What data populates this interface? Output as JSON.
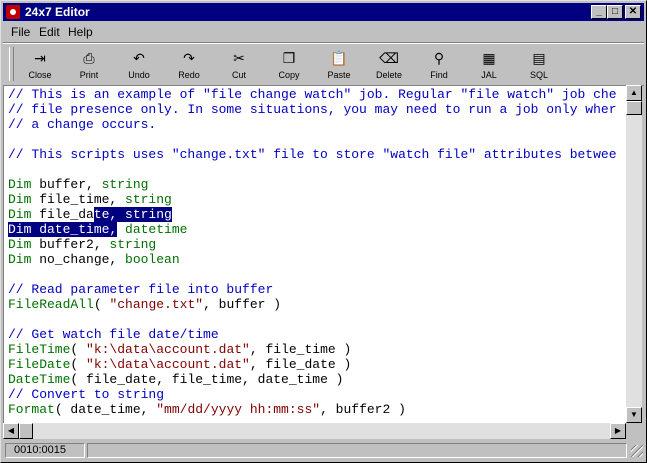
{
  "window": {
    "title": "24x7 Editor",
    "minimize": "_",
    "maximize": "□",
    "close": "✕"
  },
  "menu": [
    "File",
    "Edit",
    "Help"
  ],
  "toolbar": [
    {
      "label": "Close",
      "icon": "close-file-icon",
      "glyph": "⇥"
    },
    {
      "label": "Print",
      "icon": "printer-icon",
      "glyph": "⎙"
    },
    {
      "label": "Undo",
      "icon": "undo-icon",
      "glyph": "↶"
    },
    {
      "label": "Redo",
      "icon": "redo-icon",
      "glyph": "↷"
    },
    {
      "label": "Cut",
      "icon": "scissors-icon",
      "glyph": "✂"
    },
    {
      "label": "Copy",
      "icon": "copy-icon",
      "glyph": "❐"
    },
    {
      "label": "Paste",
      "icon": "clipboard-icon",
      "glyph": "📋"
    },
    {
      "label": "Delete",
      "icon": "eraser-icon",
      "glyph": "⌫"
    },
    {
      "label": "Find",
      "icon": "binoculars-icon",
      "glyph": "⚲"
    },
    {
      "label": "JAL",
      "icon": "jal-icon",
      "glyph": "▦"
    },
    {
      "label": "SQL",
      "icon": "sql-icon",
      "glyph": "▤"
    }
  ],
  "code": [
    "// This is an example of \"file change watch\" job. Regular \"file watch\" job che",
    "// file presence only. In some situations, you may need to run a job only wher",
    "// a change occurs.",
    "",
    "// This scripts uses \"change.txt\" file to store \"watch file\" attributes betwee",
    "",
    "Dim buffer, string",
    "Dim file_time, string",
    "Dim file_date, string",
    "Dim date_time, datetime",
    "Dim buffer2, string",
    "Dim no_change, boolean",
    "",
    "// Read parameter file into buffer",
    "FileReadAll( \"change.txt\", buffer )",
    "",
    "// Get watch file date/time",
    "FileTime( \"k:\\data\\account.dat\", file_time )",
    "FileDate( \"k:\\data\\account.dat\", file_date )",
    "DateTime( file_date, file_time, date_time )",
    "// Convert to string",
    "Format( date_time, \"mm/dd/yyyy hh:mm:ss\", buffer2 )"
  ],
  "status": {
    "position": "0010:0015"
  },
  "colors": {
    "comment": "#0000c0",
    "keyword": "#007000",
    "string": "#800000",
    "selection": "#000080"
  }
}
